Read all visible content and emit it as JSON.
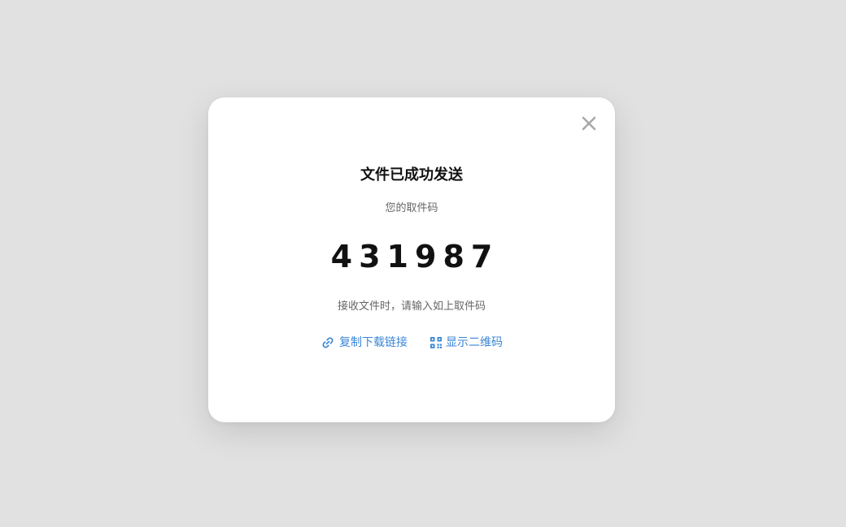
{
  "modal": {
    "title": "文件已成功发送",
    "subtitle": "您的取件码",
    "code_digits": [
      "4",
      "3",
      "1",
      "9",
      "8",
      "7"
    ],
    "hint": "接收文件时，请输入如上取件码",
    "actions": [
      {
        "label": "复制下载链接",
        "icon": "link-icon"
      },
      {
        "label": "显示二维码",
        "icon": "qr-code-icon"
      }
    ],
    "close_icon": "close-icon"
  },
  "colors": {
    "background": "#e1e1e1",
    "card": "#ffffff",
    "accent": "#3b86d6",
    "title": "#111111",
    "muted": "#666666",
    "close": "#a8a8a8"
  }
}
